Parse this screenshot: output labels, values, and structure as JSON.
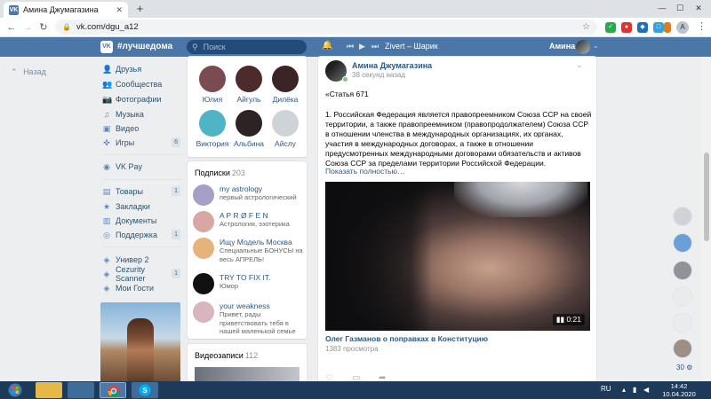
{
  "browser": {
    "tab_title": "Амина Джумагазина",
    "tab_favicon": "VK",
    "url": "vk.com/dgu_a12",
    "profile_letter": "A",
    "win_min": "—",
    "win_max": "☐",
    "win_close": "✕",
    "new_tab": "+"
  },
  "vk_header": {
    "logo": "VK",
    "hashtag": "#лучшедома",
    "search_placeholder": "Поиск",
    "now_playing": "Zivert – Шарик",
    "user_name": "Амина"
  },
  "left_nav": {
    "back_label": "Назад",
    "items": [
      {
        "icon": "user-icon",
        "glyph": "👤",
        "label": "Друзья",
        "count": ""
      },
      {
        "icon": "community-icon",
        "glyph": "👥",
        "label": "Сообщества",
        "count": ""
      },
      {
        "icon": "camera-icon",
        "glyph": "📷",
        "label": "Фотографии",
        "count": ""
      },
      {
        "icon": "music-icon",
        "glyph": "♫",
        "label": "Музыка",
        "count": ""
      },
      {
        "icon": "video-icon",
        "glyph": "▣",
        "label": "Видео",
        "count": ""
      },
      {
        "icon": "gamepad-icon",
        "glyph": "✜",
        "label": "Игры",
        "count": "6"
      },
      {
        "icon": "vkpay-icon",
        "glyph": "◉",
        "label": "VK Pay",
        "count": ""
      },
      {
        "icon": "bag-icon",
        "glyph": "▤",
        "label": "Товары",
        "count": "1"
      },
      {
        "icon": "bookmark-icon",
        "glyph": "★",
        "label": "Закладки",
        "count": ""
      },
      {
        "icon": "document-icon",
        "glyph": "▥",
        "label": "Документы",
        "count": ""
      },
      {
        "icon": "support-icon",
        "glyph": "◎",
        "label": "Поддержка",
        "count": "1"
      },
      {
        "icon": "app-icon",
        "glyph": "◈",
        "label": "Универ 2",
        "count": ""
      },
      {
        "icon": "app-icon",
        "glyph": "◈",
        "label": "Cezurity Scanner",
        "count": "1"
      },
      {
        "icon": "app-icon",
        "glyph": "◈",
        "label": "Мои Гости",
        "count": ""
      }
    ]
  },
  "friends": [
    {
      "name": "Юлия",
      "color": "#7a4b52"
    },
    {
      "name": "Айгуль",
      "color": "#4d2a2c"
    },
    {
      "name": "Дилёка",
      "color": "#3b2326"
    },
    {
      "name": "Виктория",
      "color": "#4fb4c6"
    },
    {
      "name": "Альбина",
      "color": "#2d2324"
    },
    {
      "name": "Айслу",
      "color": "#cfd2d6"
    }
  ],
  "subscriptions": {
    "title": "Подписки",
    "count": "203",
    "items": [
      {
        "name": "my astrology",
        "desc": "первый астрологический",
        "color": "#a6a0c7"
      },
      {
        "name": "A P R Ø F E N",
        "desc": "Астрология, эзотерика",
        "color": "#d8a7a5"
      },
      {
        "name": "Ищу Модель Москва",
        "desc": "Специальные БОНУСЫ на весь АПРЕЛЬ!",
        "color": "#e6b37a"
      },
      {
        "name": "TRY TO FIX IT.",
        "desc": "Юмор",
        "color": "#111111"
      },
      {
        "name": "your weakness",
        "desc": "Привет, рады приветствовать тебя в нашей маленькой семье",
        "color": "#d9b6bf"
      }
    ]
  },
  "videos_section": {
    "title": "Видеозаписи",
    "count": "112"
  },
  "post": {
    "author": "Амина Джумагазина",
    "time": "38 секунд назад",
    "heading": "«Статья 671",
    "body": "1. Российская Федерация является правопреемником Союза ССР на своей территории, а также правопреемником (правопродолжателем) Союза ССР в отношении членства в международных организациях, их органах, участия в международных договорах, а также в отношении предусмотренных международными договорами обязательств и активов Союза ССР за пределами территории Российской Федерации.",
    "show_more": "Показать полностью…",
    "video_duration": "0:21",
    "video_title": "Олег Газманов о поправках в Конституцию",
    "video_views": "1383 просмотра"
  },
  "right_panel": {
    "online_count": "30"
  },
  "taskbar": {
    "lang": "RU",
    "time": "14:42",
    "date": "10.04.2020"
  },
  "colors": {
    "vk_blue": "#4a76a8",
    "link": "#2a5885"
  }
}
